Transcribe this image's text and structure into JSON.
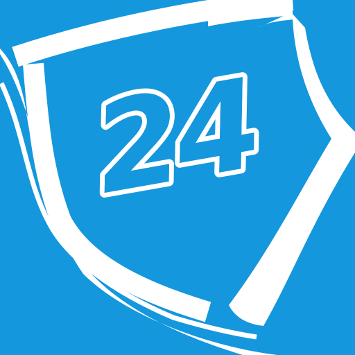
{
  "icon": {
    "name": "shield-24-icon",
    "badge_text": "24",
    "colors": {
      "background": "#1497dd",
      "foreground": "#ffffff"
    }
  }
}
